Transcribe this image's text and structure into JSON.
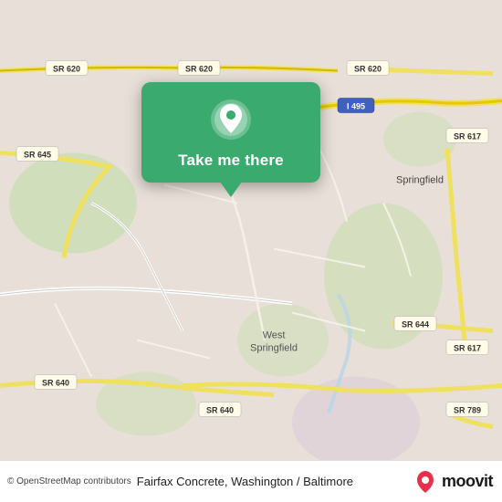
{
  "map": {
    "background_color": "#e8e0d8",
    "attribution": "© OpenStreetMap contributors"
  },
  "popup": {
    "button_label": "Take me there"
  },
  "bottom_bar": {
    "location_label": "Fairfax Concrete, Washington / Baltimore",
    "moovit_text": "moovit"
  },
  "road_labels": [
    "SR 620",
    "SR 620",
    "SR 620",
    "SR 645",
    "SR 617",
    "I 495",
    "SR 644",
    "SR 617",
    "SR 640",
    "SR 640",
    "SR 789",
    "West Springfield"
  ]
}
